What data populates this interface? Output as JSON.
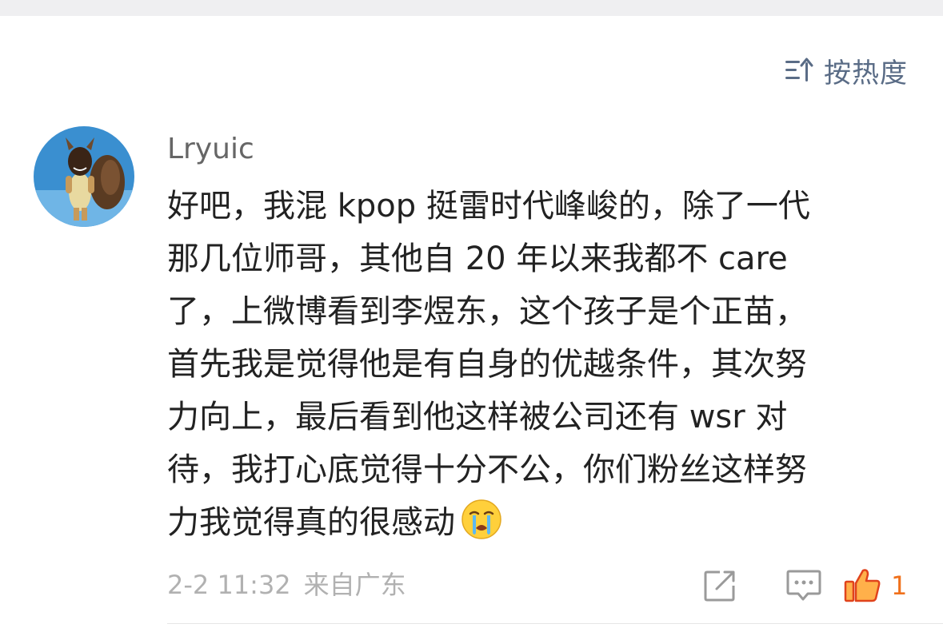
{
  "sort": {
    "icon": "sort-lines-icon",
    "label": "按热度",
    "color": "#5a6c86"
  },
  "comment": {
    "avatar_icon": "squirrel-character-avatar",
    "username": "Lryuic",
    "lines": [
      "好吧，我混 kpop 挺雷时代峰峻的，除了一代",
      "那几位师哥，其他自 20 年以来我都不 care",
      "了，上微博看到李煜东，这个孩子是个正苗，",
      "首先我是觉得他是有自身的优越条件，其次努",
      "力向上，最后看到他这样被公司还有 wsr 对",
      "待，我打心底觉得十分不公，你们粉丝这样努",
      "力我觉得真的很感动"
    ],
    "emoji": "crying-face-emoji",
    "timestamp": "2-2 11:32",
    "location": "来自广东",
    "actions": {
      "share_icon": "share-icon",
      "reply_icon": "comment-icon",
      "like_icon": "thumbs-up-icon",
      "like_count": "1",
      "like_color": "#f0711c"
    }
  }
}
